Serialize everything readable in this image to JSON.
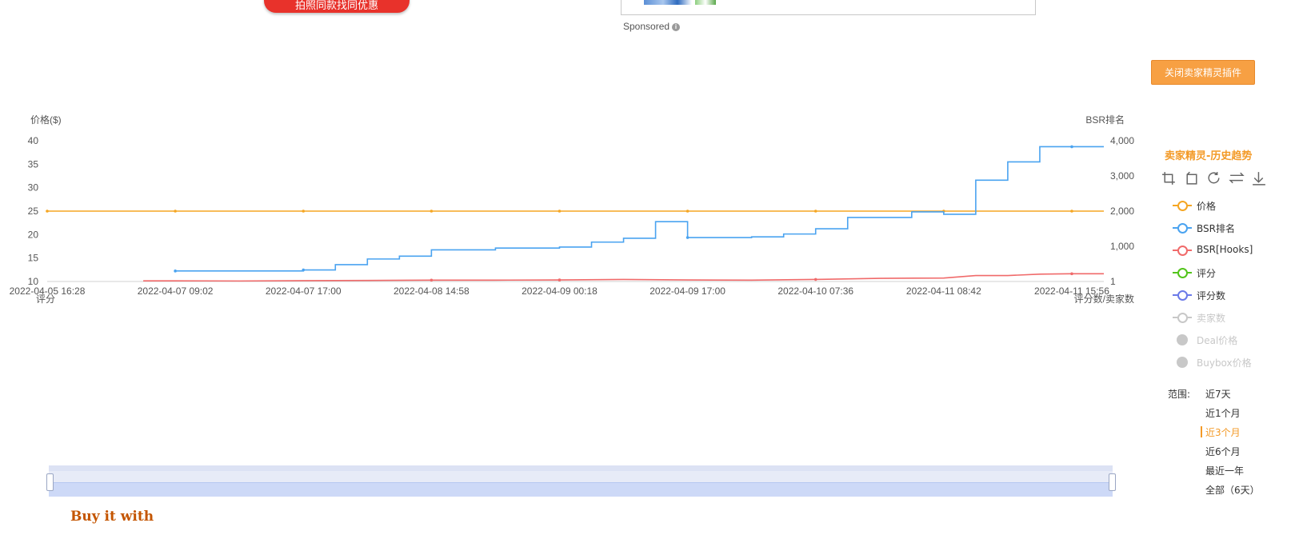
{
  "header": {
    "red_button_label": "拍照同款找同优惠",
    "sponsored_label": "Sponsored",
    "info_glyph": "i",
    "close_plugin_label": "关闭卖家精灵插件"
  },
  "panel": {
    "title": "卖家精灵-历史趋势",
    "tools": [
      "zoom-in-icon",
      "zoom-reset-icon",
      "refresh-icon",
      "swap-icon",
      "download-icon"
    ],
    "legend": [
      {
        "label": "价格",
        "color": "#f5a623",
        "style": "circle",
        "enabled": true
      },
      {
        "label": "BSR排名",
        "color": "#4aa3f0",
        "style": "circle",
        "enabled": true
      },
      {
        "label": "BSR[Hooks]",
        "color": "#f06a6a",
        "style": "circle",
        "enabled": true
      },
      {
        "label": "评分",
        "color": "#52c41a",
        "style": "circle",
        "enabled": true
      },
      {
        "label": "评分数",
        "color": "#6b7ae8",
        "style": "circle",
        "enabled": true
      },
      {
        "label": "卖家数",
        "color": "#c8c8c8",
        "style": "circle",
        "enabled": false
      },
      {
        "label": "Deal价格",
        "color": "#c8c8c8",
        "style": "dot",
        "enabled": false
      },
      {
        "label": "Buybox价格",
        "color": "#c8c8c8",
        "style": "dot",
        "enabled": false
      }
    ],
    "range_label": "范围:",
    "range_options": [
      "近7天",
      "近1个月",
      "近3个月",
      "近6个月",
      "最近一年",
      "全部（6天）"
    ],
    "range_active_index": 2
  },
  "footer": {
    "buy_it_with": "Buy it with"
  },
  "chart_data": {
    "type": "line",
    "left_axis_label": "价格($)",
    "right_axis_label": "BSR排名",
    "left_bottom_label": "评分",
    "right_bottom_label": "评分数/卖家数",
    "ylim_left": [
      10,
      40
    ],
    "yticks_left": [
      "10",
      "15",
      "20",
      "25",
      "30",
      "35",
      "40"
    ],
    "ylim_right": [
      1,
      4000
    ],
    "yticks_right": [
      "1",
      "1,000",
      "2,000",
      "3,000",
      "4,000"
    ],
    "x_tick_labels": [
      "2022-04-05 16:28",
      "2022-04-07 09:02",
      "2022-04-07 17:00",
      "2022-04-08 14:58",
      "2022-04-09 00:18",
      "2022-04-09 17:00",
      "2022-04-10 07:36",
      "2022-04-11 08:42",
      "2022-04-11 15:56"
    ],
    "x_range": [
      0,
      8.25
    ],
    "grid": false,
    "series": [
      {
        "name": "价格",
        "axis": "left",
        "color": "#f5a623",
        "step": false,
        "points": [
          [
            0,
            25
          ],
          [
            1,
            25
          ],
          [
            2,
            25
          ],
          [
            3,
            25
          ],
          [
            4,
            25
          ],
          [
            5,
            25
          ],
          [
            6,
            25
          ],
          [
            7,
            25
          ],
          [
            8,
            25
          ],
          [
            8.25,
            25
          ]
        ],
        "markers": [
          0,
          1,
          2,
          3,
          4,
          5,
          6,
          7,
          8
        ]
      },
      {
        "name": "BSR排名",
        "axis": "right",
        "color": "#4aa3f0",
        "step": true,
        "points": [
          [
            1,
            300
          ],
          [
            2,
            330
          ],
          [
            2.25,
            480
          ],
          [
            2.5,
            640
          ],
          [
            2.75,
            720
          ],
          [
            3,
            900
          ],
          [
            3.5,
            950
          ],
          [
            4,
            980
          ],
          [
            4.25,
            1120
          ],
          [
            4.5,
            1230
          ],
          [
            4.75,
            1700
          ],
          [
            5,
            1250
          ],
          [
            5.5,
            1270
          ],
          [
            5.75,
            1350
          ],
          [
            6,
            1500
          ],
          [
            6.25,
            1820
          ],
          [
            6.75,
            1980
          ],
          [
            7,
            1910
          ],
          [
            7.25,
            2880
          ],
          [
            7.5,
            3400
          ],
          [
            7.75,
            3830
          ],
          [
            8.25,
            3830
          ]
        ],
        "markers": [
          1,
          2,
          5,
          8
        ]
      },
      {
        "name": "BSR[Hooks]",
        "axis": "right",
        "color": "#f06a6a",
        "step": false,
        "points": [
          [
            0.75,
            20
          ],
          [
            1,
            20
          ],
          [
            1.5,
            15
          ],
          [
            2,
            25
          ],
          [
            2.5,
            30
          ],
          [
            3,
            40
          ],
          [
            3.5,
            40
          ],
          [
            4,
            45
          ],
          [
            4.5,
            60
          ],
          [
            5,
            45
          ],
          [
            5.5,
            40
          ],
          [
            6,
            60
          ],
          [
            6.5,
            90
          ],
          [
            7,
            100
          ],
          [
            7.25,
            170
          ],
          [
            7.5,
            170
          ],
          [
            7.75,
            210
          ],
          [
            8,
            220
          ],
          [
            8.25,
            220
          ]
        ],
        "markers": [
          3,
          4,
          6,
          8
        ]
      }
    ]
  }
}
